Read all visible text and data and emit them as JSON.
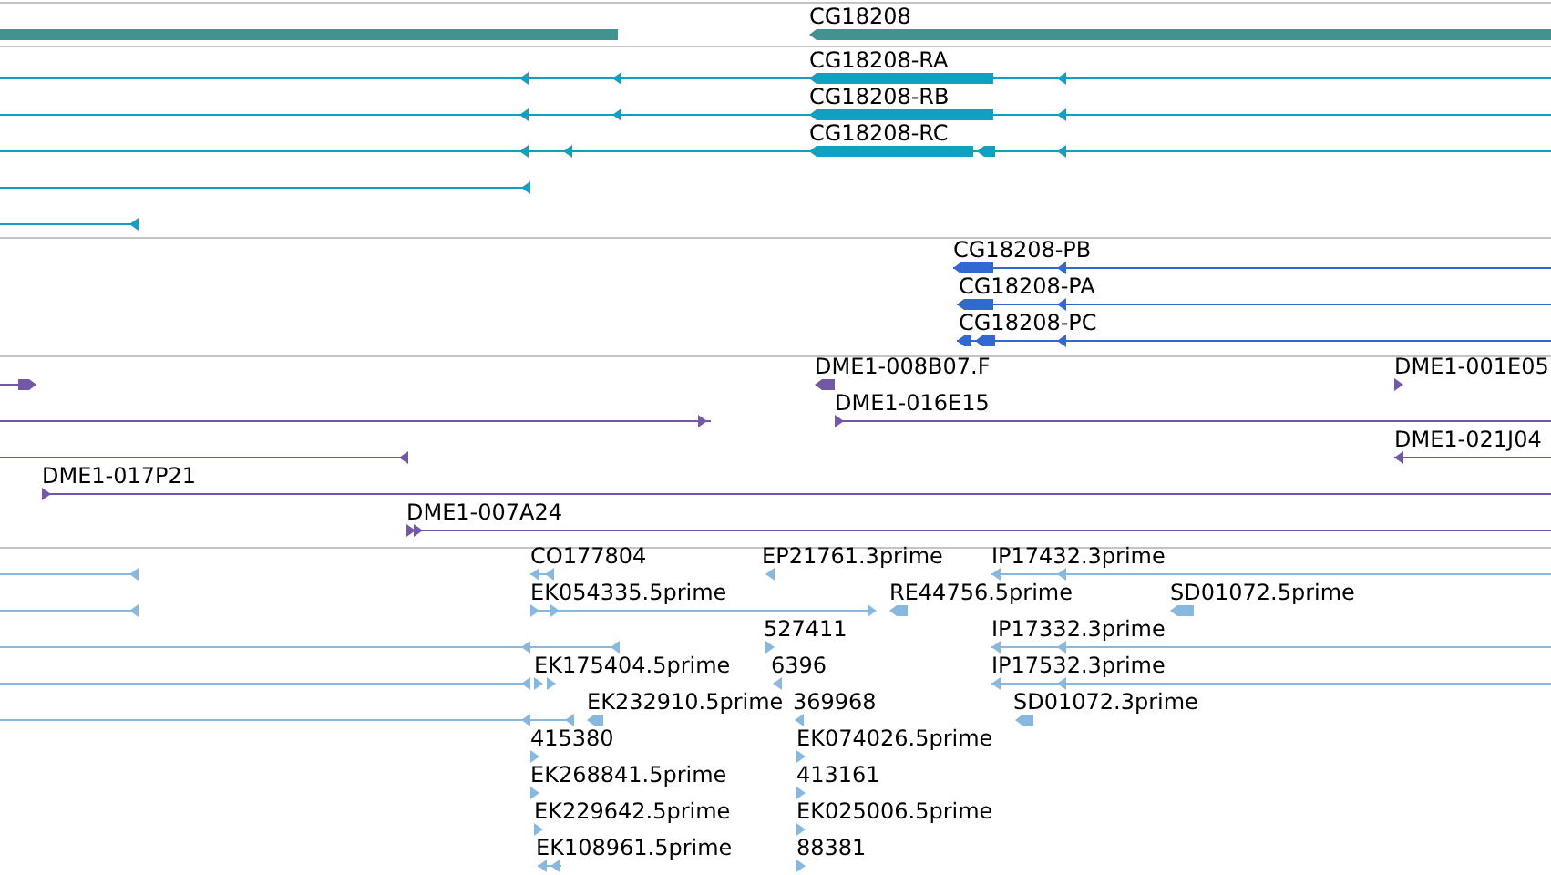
{
  "tracks": [
    {
      "kind": "gene",
      "features": [
        {
          "label": "CG18208"
        }
      ]
    },
    {
      "kind": "transcript",
      "features": [
        {
          "label": "CG18208-RA"
        },
        {
          "label": "CG18208-RB"
        },
        {
          "label": "CG18208-RC"
        }
      ]
    },
    {
      "kind": "protein",
      "features": [
        {
          "label": "CG18208-PB"
        },
        {
          "label": "CG18208-PA"
        },
        {
          "label": "CG18208-PC"
        }
      ]
    },
    {
      "kind": "clone",
      "features": [
        {
          "label": "DME1-008B07.F"
        },
        {
          "label": "DME1-001E05"
        },
        {
          "label": "DME1-016E15"
        },
        {
          "label": "DME1-021J04"
        },
        {
          "label": "DME1-017P21"
        },
        {
          "label": "DME1-007A24"
        }
      ]
    },
    {
      "kind": "est",
      "features": [
        {
          "label": "CO177804"
        },
        {
          "label": "EP21761.3prime"
        },
        {
          "label": "IP17432.3prime"
        },
        {
          "label": "EK054335.5prime"
        },
        {
          "label": "RE44756.5prime"
        },
        {
          "label": "SD01072.5prime"
        },
        {
          "label": "527411"
        },
        {
          "label": "IP17332.3prime"
        },
        {
          "label": "EK175404.5prime"
        },
        {
          "label": "6396"
        },
        {
          "label": "IP17532.3prime"
        },
        {
          "label": "EK232910.5prime"
        },
        {
          "label": "369968"
        },
        {
          "label": "SD01072.3prime"
        },
        {
          "label": "415380"
        },
        {
          "label": "EK074026.5prime"
        },
        {
          "label": "EK268841.5prime"
        },
        {
          "label": "413161"
        },
        {
          "label": "EK229642.5prime"
        },
        {
          "label": "EK025006.5prime"
        },
        {
          "label": "EK108961.5prime"
        },
        {
          "label": "88381"
        }
      ]
    }
  ]
}
